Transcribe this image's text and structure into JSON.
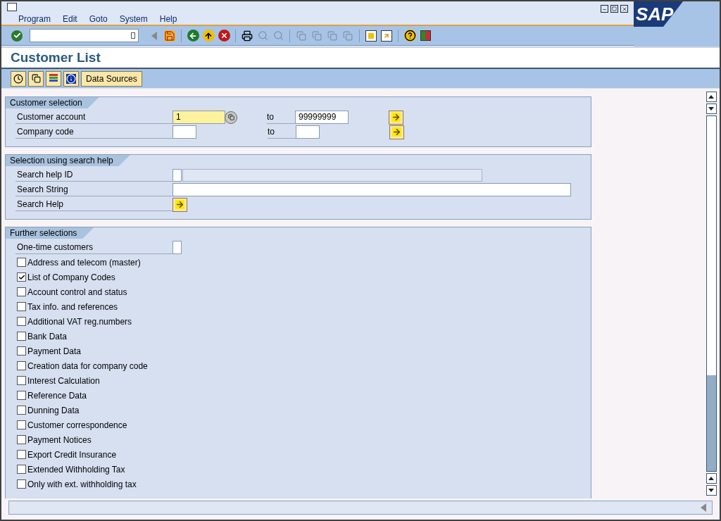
{
  "menu": [
    {
      "label": "Program"
    },
    {
      "label": "Edit"
    },
    {
      "label": "Goto"
    },
    {
      "label": "System"
    },
    {
      "label": "Help"
    }
  ],
  "logo": "SAP",
  "title": "Customer List",
  "app_toolbar": {
    "button": "Data Sources"
  },
  "sections": [
    {
      "title": "Customer selection",
      "rows": [
        {
          "kind": "range",
          "label": "Customer account",
          "from": "1",
          "to_label": "to",
          "to": "99999999",
          "highlighted": true
        },
        {
          "kind": "range",
          "label": "Company code",
          "from": "",
          "to_label": "to",
          "to": "",
          "highlighted": false
        }
      ]
    },
    {
      "title": "Selection using search help",
      "rows": [
        {
          "kind": "split",
          "label": "Search help ID"
        },
        {
          "kind": "field",
          "label": "Search String"
        },
        {
          "kind": "button",
          "label": "Search Help"
        }
      ]
    },
    {
      "title": "Further selections",
      "rows": [
        {
          "kind": "small",
          "label": "One-time customers"
        },
        {
          "kind": "checkbox",
          "label": "Address and telecom (master)",
          "checked": false
        },
        {
          "kind": "checkbox",
          "label": "List of Company Codes",
          "checked": true
        },
        {
          "kind": "checkbox",
          "label": "Account control and status",
          "checked": false
        },
        {
          "kind": "checkbox",
          "label": "Tax info. and references",
          "checked": false
        },
        {
          "kind": "checkbox",
          "label": "Additional VAT reg.numbers",
          "checked": false
        },
        {
          "kind": "checkbox",
          "label": "Bank Data",
          "checked": false
        },
        {
          "kind": "checkbox",
          "label": "Payment Data",
          "checked": false
        },
        {
          "kind": "checkbox",
          "label": "Creation data for company code",
          "checked": false
        },
        {
          "kind": "checkbox",
          "label": "Interest Calculation",
          "checked": false
        },
        {
          "kind": "checkbox",
          "label": "Reference Data",
          "checked": false
        },
        {
          "kind": "checkbox",
          "label": "Dunning Data",
          "checked": false
        },
        {
          "kind": "checkbox",
          "label": "Customer correspondence",
          "checked": false
        },
        {
          "kind": "checkbox",
          "label": "Payment Notices",
          "checked": false
        },
        {
          "kind": "checkbox",
          "label": "Export Credit Insurance",
          "checked": false
        },
        {
          "kind": "checkbox",
          "label": "Extended Withholding Tax",
          "checked": false
        },
        {
          "kind": "checkbox",
          "label": "Only with ext. withholding tax",
          "checked": false
        }
      ]
    }
  ]
}
